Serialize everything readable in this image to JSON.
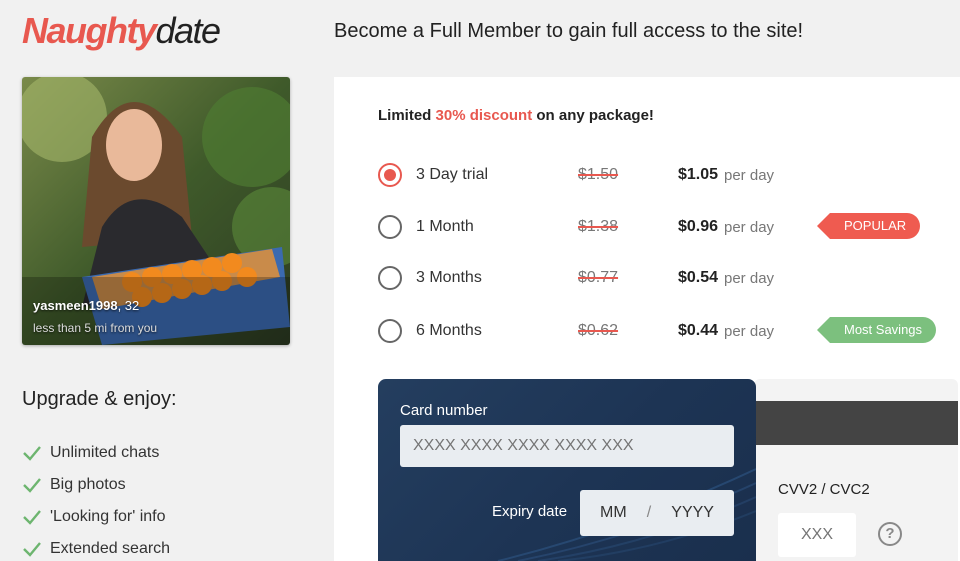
{
  "logo": {
    "part1": "Naughty",
    "part2": "date"
  },
  "headline": "Become a Full Member to gain full access to the site!",
  "profile": {
    "username": "yasmeen1998",
    "age": ", 32",
    "distance": "less than 5 mi from you"
  },
  "upgrade": {
    "title": "Upgrade & enjoy:",
    "features": [
      "Unlimited chats",
      "Big photos",
      "'Looking for' info",
      "Extended search"
    ]
  },
  "promo": {
    "prefix": "Limited ",
    "highlight": "30% discount",
    "suffix": " on any package!"
  },
  "plans": [
    {
      "name": "3 Day trial",
      "old_price": "$1.50",
      "new_price": "$1.05",
      "per": "per day",
      "selected": true,
      "tag": ""
    },
    {
      "name": "1 Month",
      "old_price": "$1.38",
      "new_price": "$0.96",
      "per": "per day",
      "selected": false,
      "tag": "POPULAR"
    },
    {
      "name": "3 Months",
      "old_price": "$0.77",
      "new_price": "$0.54",
      "per": "per day",
      "selected": false,
      "tag": ""
    },
    {
      "name": "6 Months",
      "old_price": "$0.62",
      "new_price": "$0.44",
      "per": "per day",
      "selected": false,
      "tag": "Most Savings"
    }
  ],
  "card": {
    "number_label": "Card number",
    "number_placeholder": "XXXX XXXX XXXX XXXX XXX",
    "expiry_label": "Expiry date",
    "month_placeholder": "MM",
    "slash": "/",
    "year_placeholder": "YYYY",
    "cvv_label": "CVV2 / CVC2",
    "cvv_placeholder": "XXX",
    "help_symbol": "?"
  },
  "colors": {
    "accent": "#e8584f",
    "popular": "#ef5b50",
    "savings": "#7cc07e",
    "check": "#6db56f",
    "card": "#1d3454"
  },
  "icons": {
    "check": "check-icon",
    "help": "question-circle-icon"
  }
}
